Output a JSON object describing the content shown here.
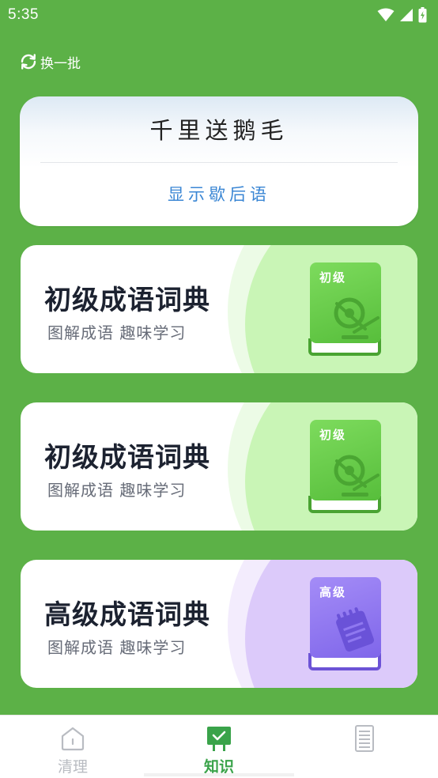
{
  "status_bar": {
    "time": "5:35"
  },
  "refresh": {
    "label": "换一批"
  },
  "riddle": {
    "text": "千里送鹅毛",
    "toggle_label": "显示歇后语"
  },
  "cards": [
    {
      "title": "初级成语词典",
      "subtitle": "图解成语 趣味学习",
      "book_label": "初级",
      "theme": "green"
    },
    {
      "title": "初级成语词典",
      "subtitle": "图解成语 趣味学习",
      "book_label": "初级",
      "theme": "green"
    },
    {
      "title": "高级成语词典",
      "subtitle": "图解成语 趣味学习",
      "book_label": "高级",
      "theme": "purple"
    }
  ],
  "tabs": [
    {
      "label": "清理",
      "icon": "home-icon",
      "active": false
    },
    {
      "label": "知识",
      "icon": "easel-check-icon",
      "active": true
    },
    {
      "label": "",
      "icon": "document-icon",
      "active": false
    }
  ],
  "colors": {
    "background": "#5cb147",
    "accent_blue": "#3a86d4",
    "active_tab": "#3aa34a",
    "inactive_tab": "#b9bcc2"
  }
}
